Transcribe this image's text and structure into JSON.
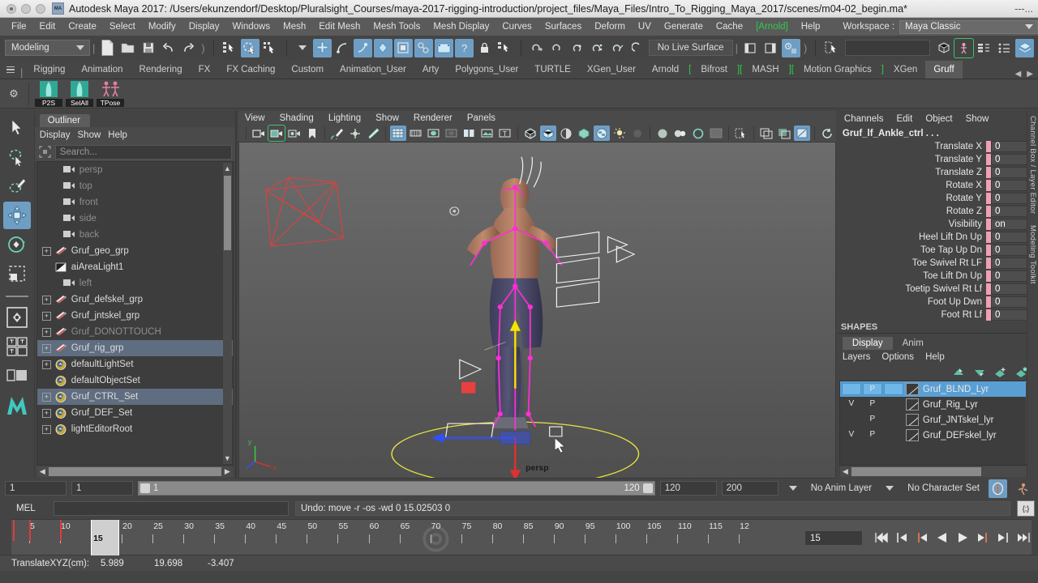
{
  "window": {
    "title": "Autodesk Maya 2017: /Users/ekunzendorf/Desktop/Pluralsight_Courses/maya-2017-rigging-introduction/project_files/Maya_Files/Intro_To_Rigging_Maya_2017/scenes/m04-02_begin.ma*",
    "title_tail": "---...",
    "app_badge": "MA"
  },
  "menubar": {
    "items": [
      "File",
      "Edit",
      "Create",
      "Select",
      "Modify",
      "Display",
      "Windows",
      "Mesh",
      "Edit Mesh",
      "Mesh Tools",
      "Mesh Display",
      "Curves",
      "Surfaces",
      "Deform",
      "UV",
      "Generate",
      "Cache",
      "Arnold",
      "Help"
    ],
    "arnold_item": "Arnold",
    "workspace_label": "Workspace :",
    "workspace_value": "Maya Classic"
  },
  "statusline": {
    "mode_value": "Modeling",
    "no_live_surface": "No Live Surface",
    "input_value": ""
  },
  "shelf_tabs": {
    "items": [
      "Rigging",
      "Animation",
      "Rendering",
      "FX",
      "FX Caching",
      "Custom",
      "Animation_User",
      "Arty",
      "Polygons_User",
      "TURTLE",
      "XGen_User",
      "Arnold",
      "Bifrost",
      "MASH",
      "Motion Graphics",
      "XGen",
      "Gruff"
    ],
    "active": "Gruff",
    "bracketed": [
      "Bifrost",
      "MASH",
      "Motion Graphics"
    ]
  },
  "shelf_buttons": [
    {
      "label": "P2S",
      "name": "shelf-button-p2s"
    },
    {
      "label": "SelAll",
      "name": "shelf-button-selall"
    },
    {
      "label": "TPose",
      "name": "shelf-button-tpose"
    }
  ],
  "outliner": {
    "tab_title": "Outliner",
    "menu": [
      "Display",
      "Show",
      "Help"
    ],
    "search_placeholder": "Search...",
    "items": [
      {
        "label": "persp",
        "icon": "camera-icon",
        "expandable": false,
        "dim": true,
        "selected": false,
        "indent": 1
      },
      {
        "label": "top",
        "icon": "camera-icon",
        "expandable": false,
        "dim": true,
        "selected": false,
        "indent": 1
      },
      {
        "label": "front",
        "icon": "camera-icon",
        "expandable": false,
        "dim": true,
        "selected": false,
        "indent": 1
      },
      {
        "label": "side",
        "icon": "camera-icon",
        "expandable": false,
        "dim": true,
        "selected": false,
        "indent": 1
      },
      {
        "label": "back",
        "icon": "camera-icon",
        "expandable": false,
        "dim": true,
        "selected": false,
        "indent": 1
      },
      {
        "label": "Gruf_geo_grp",
        "icon": "group-icon",
        "expandable": true,
        "dim": false,
        "selected": false,
        "indent": 0
      },
      {
        "label": "aiAreaLight1",
        "icon": "arealight-icon",
        "expandable": false,
        "dim": false,
        "selected": false,
        "indent": 0
      },
      {
        "label": "left",
        "icon": "camera-icon",
        "expandable": false,
        "dim": true,
        "selected": false,
        "indent": 1
      },
      {
        "label": "Gruf_defskel_grp",
        "icon": "group-icon",
        "expandable": true,
        "dim": false,
        "selected": false,
        "indent": 0
      },
      {
        "label": "Gruf_jntskel_grp",
        "icon": "group-icon",
        "expandable": true,
        "dim": false,
        "selected": false,
        "indent": 0
      },
      {
        "label": "Gruf_DONOTTOUCH",
        "icon": "group-icon",
        "expandable": true,
        "dim": true,
        "selected": false,
        "indent": 0
      },
      {
        "label": "Gruf_rig_grp",
        "icon": "group-icon",
        "expandable": true,
        "dim": false,
        "selected": true,
        "indent": 0
      },
      {
        "label": "defaultLightSet",
        "icon": "set-icon",
        "expandable": true,
        "dim": false,
        "selected": false,
        "indent": 0
      },
      {
        "label": "defaultObjectSet",
        "icon": "set-icon",
        "expandable": false,
        "dim": false,
        "selected": false,
        "indent": 0
      },
      {
        "label": "Gruf_CTRL_Set",
        "icon": "set-icon",
        "expandable": true,
        "dim": false,
        "selected": true,
        "indent": 0
      },
      {
        "label": "Gruf_DEF_Set",
        "icon": "set-icon",
        "expandable": true,
        "dim": false,
        "selected": false,
        "indent": 0
      },
      {
        "label": "lightEditorRoot",
        "icon": "set-icon",
        "expandable": true,
        "dim": false,
        "selected": false,
        "indent": 0
      }
    ]
  },
  "viewport": {
    "menu": [
      "View",
      "Shading",
      "Lighting",
      "Show",
      "Renderer",
      "Panels"
    ],
    "camera_label": "persp",
    "background_top": "#6a6a6a",
    "background_bottom": "#4e4e4e"
  },
  "channelbox": {
    "menu": [
      "Channels",
      "Edit",
      "Object",
      "Show"
    ],
    "object_name": "Gruf_lf_Ankle_ctrl . . .",
    "shapes_label": "SHAPES",
    "attributes": [
      {
        "name": "Translate X",
        "value": "0"
      },
      {
        "name": "Translate Y",
        "value": "0"
      },
      {
        "name": "Translate Z",
        "value": "0"
      },
      {
        "name": "Rotate X",
        "value": "0"
      },
      {
        "name": "Rotate Y",
        "value": "0"
      },
      {
        "name": "Rotate Z",
        "value": "0"
      },
      {
        "name": "Visibility",
        "value": "on"
      },
      {
        "name": "Heel Lift Dn Up",
        "value": "0"
      },
      {
        "name": "Toe Tap Up Dn",
        "value": "0"
      },
      {
        "name": "Toe Swivel Rt LF",
        "value": "0"
      },
      {
        "name": "Toe Lift Dn Up",
        "value": "0"
      },
      {
        "name": "Toetip Swivel Rt Lf",
        "value": "0"
      },
      {
        "name": "Foot Up Dwn",
        "value": "0"
      },
      {
        "name": "Foot Rt Lf",
        "value": "0"
      }
    ]
  },
  "layer_editor": {
    "tabs": [
      "Display",
      "Anim"
    ],
    "active_tab": "Display",
    "menu": [
      "Layers",
      "Options",
      "Help"
    ],
    "rows": [
      {
        "v": "",
        "p": "P",
        "third": "",
        "name": "Gruf_BLND_Lyr",
        "selected": true
      },
      {
        "v": "V",
        "p": "P",
        "third": "",
        "name": "Gruf_Rig_Lyr",
        "selected": false
      },
      {
        "v": "",
        "p": "P",
        "third": "",
        "name": "Gruf_JNTskel_lyr",
        "selected": false
      },
      {
        "v": "V",
        "p": "P",
        "third": "",
        "name": "Gruf_DEFskel_lyr",
        "selected": false
      }
    ]
  },
  "range": {
    "start_field": "1",
    "anim_start_field": "1",
    "slider_min": "1",
    "slider_max": "120",
    "anim_end_field": "120",
    "end_field": "200",
    "anim_layer": "No Anim Layer",
    "character_set": "No Character Set"
  },
  "mel": {
    "label": "MEL",
    "command": "",
    "output": "Undo: move -r -os -wd 0 15.02503 0"
  },
  "timeline": {
    "ticks": [
      "5",
      "10",
      "15",
      "20",
      "25",
      "30",
      "35",
      "40",
      "45",
      "50",
      "55",
      "60",
      "65",
      "70",
      "75",
      "80",
      "85",
      "90",
      "95",
      "100",
      "105",
      "110",
      "115",
      "12"
    ],
    "current_frame": "15",
    "current_frame_field": "15",
    "keyframes": [
      1,
      5,
      10
    ],
    "range_start": 1,
    "range_end": 120
  },
  "helpline": {
    "label": "TranslateXYZ(cm):",
    "x": "5.989",
    "y": "19.698",
    "z": "-3.407"
  },
  "dock": {
    "labels": [
      "Channel Box / Layer Editor",
      "Modeling Toolkit"
    ]
  },
  "colors": {
    "accent_blue": "#6f9ec4",
    "layer_selected": "#5a9fd4",
    "outliner_selected": "#5f6d80",
    "arnold_green": "#2ecc4a",
    "channel_lock_pink": "#f0a0b4",
    "keyframe_red": "#e03b3b"
  }
}
